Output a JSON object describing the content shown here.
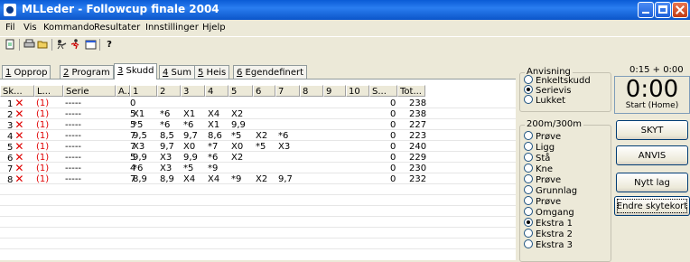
{
  "window": {
    "title": "MLLeder - Followcup finale 2004"
  },
  "menu": [
    "Fil",
    "Vis",
    "Kommando",
    "Resultater",
    "Innstillinger",
    "Hjelp"
  ],
  "toolbar": {
    "icons": [
      "new-icon",
      "print-icon",
      "open-icon",
      "shooter-icon",
      "run-icon",
      "window-icon",
      "help-icon"
    ],
    "help_glyph": "?"
  },
  "tabs": [
    {
      "num": "1",
      "label": " Opprop"
    },
    {
      "num": "2",
      "label": " Program"
    },
    {
      "num": "3",
      "label": " Skudd"
    },
    {
      "num": "4",
      "label": " Sum"
    },
    {
      "num": "5",
      "label": " Heis"
    },
    {
      "num": "6",
      "label": " Egendefinert"
    }
  ],
  "grid": {
    "headers": [
      "Sk...",
      "L...",
      "Serie",
      "A...",
      "1",
      "2",
      "3",
      "4",
      "5",
      "6",
      "7",
      "8",
      "9",
      "10",
      "S...",
      "Tot..."
    ],
    "rows": [
      {
        "sk": "1",
        "mark": "✕",
        "l": "(1)",
        "serie": "-----",
        "a": "0",
        "shots": [
          "",
          "",
          "",
          "",
          "",
          "",
          "",
          "",
          "",
          ""
        ],
        "s": "0",
        "tot": "238"
      },
      {
        "sk": "2",
        "mark": "✕",
        "l": "(1)",
        "serie": "-----",
        "a": "5",
        "shots": [
          "X1",
          "*6",
          "X1",
          "X4",
          "X2",
          "",
          "",
          "",
          "",
          ""
        ],
        "s": "0",
        "tot": "238"
      },
      {
        "sk": "3",
        "mark": "✕",
        "l": "(1)",
        "serie": "-----",
        "a": "5",
        "shots": [
          "*5",
          "*6",
          "*6",
          "X1",
          "9,9",
          "",
          "",
          "",
          "",
          ""
        ],
        "s": "0",
        "tot": "227"
      },
      {
        "sk": "4",
        "mark": "✕",
        "l": "(1)",
        "serie": "-----",
        "a": "7",
        "shots": [
          "9,5",
          "8,5",
          "9,7",
          "8,6",
          "*5",
          "X2",
          "*6",
          "",
          "",
          ""
        ],
        "s": "0",
        "tot": "223"
      },
      {
        "sk": "5",
        "mark": "✕",
        "l": "(1)",
        "serie": "-----",
        "a": "7",
        "shots": [
          "X3",
          "9,7",
          "X0",
          "*7",
          "X0",
          "*5",
          "X3",
          "",
          "",
          ""
        ],
        "s": "0",
        "tot": "240"
      },
      {
        "sk": "6",
        "mark": "✕",
        "l": "(1)",
        "serie": "-----",
        "a": "5",
        "shots": [
          "9,9",
          "X3",
          "9,9",
          "*6",
          "X2",
          "",
          "",
          "",
          "",
          ""
        ],
        "s": "0",
        "tot": "229"
      },
      {
        "sk": "7",
        "mark": "✕",
        "l": "(1)",
        "serie": "-----",
        "a": "4",
        "shots": [
          "*6",
          "X3",
          "*5",
          "*9",
          "",
          "",
          "",
          "",
          "",
          ""
        ],
        "s": "0",
        "tot": "230"
      },
      {
        "sk": "8",
        "mark": "✕",
        "l": "(1)",
        "serie": "-----",
        "a": "7",
        "shots": [
          "8,9",
          "8,9",
          "X4",
          "X4",
          "*9",
          "X2",
          "9,7",
          "",
          "",
          ""
        ],
        "s": "0",
        "tot": "232"
      }
    ]
  },
  "anvisning": {
    "title": "Anvisning",
    "options": [
      {
        "label": "Enkeltskudd",
        "selected": false
      },
      {
        "label": "Serievis",
        "selected": true
      },
      {
        "label": "Lukket",
        "selected": false
      }
    ]
  },
  "timer": {
    "range": "0:15 + 0:00",
    "display": "0:00",
    "caption": "Start (Home)"
  },
  "program": {
    "title": "200m/300m",
    "options": [
      {
        "label": "Prøve",
        "selected": false
      },
      {
        "label": "Ligg",
        "selected": false
      },
      {
        "label": "Stå",
        "selected": false
      },
      {
        "label": "Kne",
        "selected": false
      },
      {
        "label": "Prøve",
        "selected": false
      },
      {
        "label": "Grunnlag",
        "selected": false
      },
      {
        "label": "Prøve",
        "selected": false
      },
      {
        "label": "Omgang",
        "selected": false
      },
      {
        "label": "Ekstra 1",
        "selected": true
      },
      {
        "label": "Ekstra 2",
        "selected": false
      },
      {
        "label": "Ekstra 3",
        "selected": false
      }
    ]
  },
  "buttons": {
    "skyt": "SKYT",
    "anvis": "ANVIS",
    "nytt_lag": "Nytt lag",
    "endre": "Endre skytekort"
  }
}
